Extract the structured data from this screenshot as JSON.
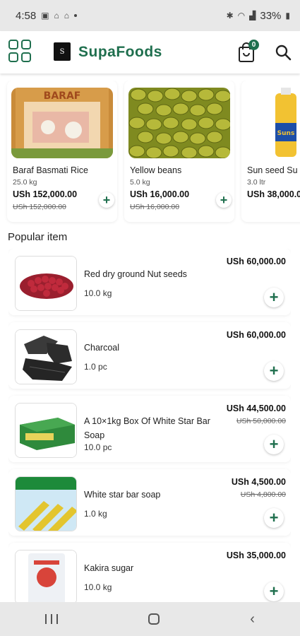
{
  "status_bar": {
    "time": "4:58",
    "battery": "33%"
  },
  "app_bar": {
    "title": "SupaFoods",
    "cart_count": "0",
    "logo_text": "S"
  },
  "featured": [
    {
      "name": "Baraf Basmati Rice",
      "unit": "25.0 kg",
      "price": "USh 152,000.00",
      "old_price": "USh 152,000.00",
      "add": "+"
    },
    {
      "name": "Yellow beans",
      "unit": "5.0 kg",
      "price": "USh 16,000.00",
      "old_price": "USh 16,000.00",
      "add": "+"
    },
    {
      "name": "Sun seed  Su",
      "unit": "3.0 ltr",
      "price": "USh 38,000.0",
      "add": "+"
    }
  ],
  "section_title": "Popular item",
  "popular": [
    {
      "name": "Red dry ground Nut seeds",
      "unit": "10.0 kg",
      "price": "USh 60,000.00",
      "add": "+"
    },
    {
      "name": "Charcoal",
      "unit": "1.0 pc",
      "price": "USh 60,000.00",
      "add": "+"
    },
    {
      "name": "A 10×1kg Box Of White Star Bar Soap",
      "unit": "10.0 pc",
      "price": "USh 44,500.00",
      "old_price": "USh 50,000.00",
      "add": "+"
    },
    {
      "name": "White star bar soap",
      "unit": "1.0 kg",
      "price": "USh 4,500.00",
      "old_price": "USh 4,800.00",
      "add": "+"
    },
    {
      "name": "Kakira sugar",
      "unit": "10.0 kg",
      "price": "USh 35,000.00",
      "add": "+"
    }
  ],
  "colors": {
    "brand": "#1f6f4e",
    "status_bar": "#e8e8e8"
  }
}
